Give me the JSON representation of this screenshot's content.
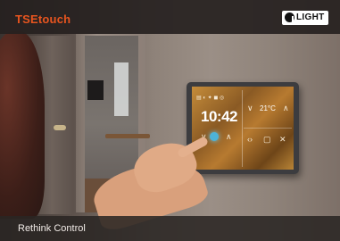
{
  "header": {
    "brand": "TSEtouch",
    "logo_text": "LIGHT"
  },
  "panel": {
    "time": "10:42",
    "temperature": "21°C"
  },
  "footer": {
    "tagline": "Rethink Control"
  },
  "colors": {
    "brand_orange": "#e8551f",
    "bar_bg": "#2a2523"
  }
}
